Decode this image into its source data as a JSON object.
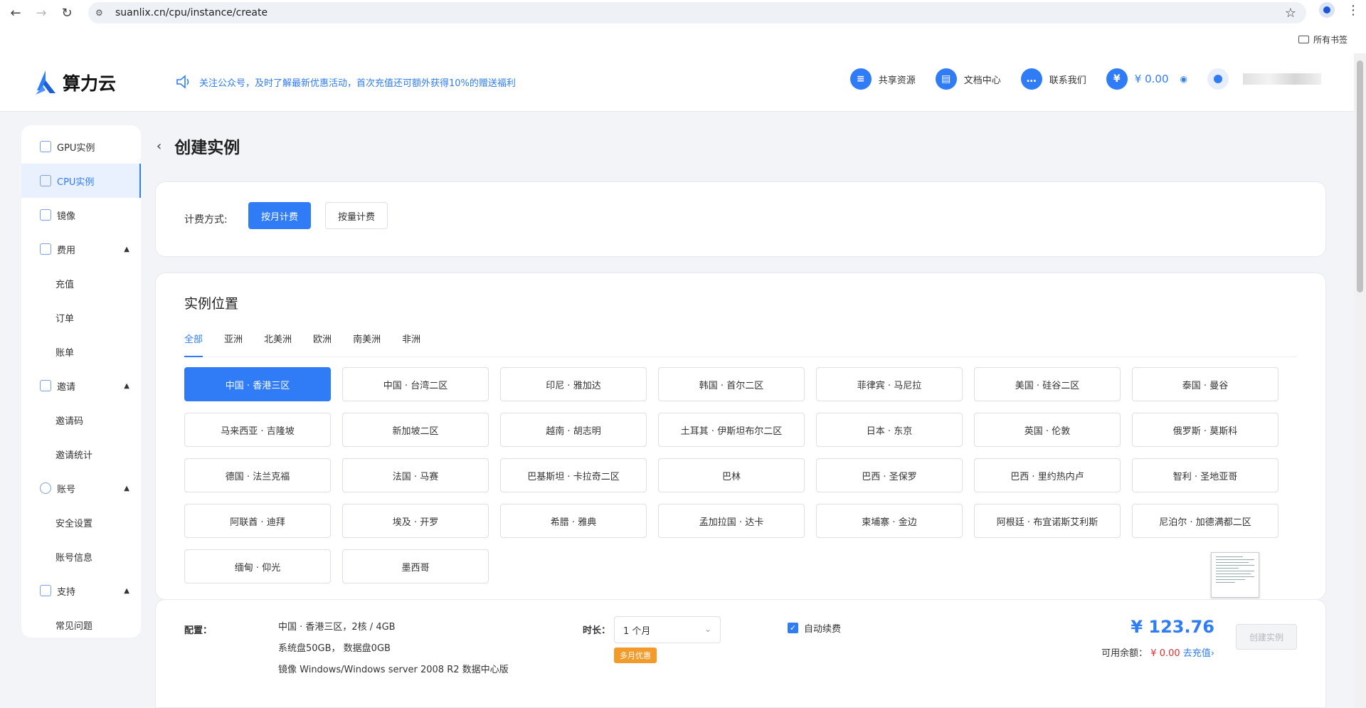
{
  "browser": {
    "url": "suanlix.cn/cpu/instance/create",
    "bookmarks_label": "所有书签"
  },
  "header": {
    "brand": "算力云",
    "notice": "关注公众号，及时了解最新优惠活动，首次充值还可额外获得10%的赠送福利",
    "links": [
      {
        "label": "共享资源",
        "icon": "database-icon"
      },
      {
        "label": "文档中心",
        "icon": "document-icon"
      },
      {
        "label": "联系我们",
        "icon": "chat-icon"
      }
    ],
    "balance": "¥ 0.00",
    "accent": "#2f7cf6"
  },
  "sidebar": {
    "items": [
      {
        "label": "GPU实例",
        "type": "item"
      },
      {
        "label": "CPU实例",
        "type": "item",
        "active": true
      },
      {
        "label": "镜像",
        "type": "item"
      },
      {
        "label": "费用",
        "type": "group"
      },
      {
        "label": "充值",
        "type": "sub"
      },
      {
        "label": "订单",
        "type": "sub"
      },
      {
        "label": "账单",
        "type": "sub"
      },
      {
        "label": "邀请",
        "type": "group"
      },
      {
        "label": "邀请码",
        "type": "sub"
      },
      {
        "label": "邀请统计",
        "type": "sub"
      },
      {
        "label": "账号",
        "type": "group"
      },
      {
        "label": "安全设置",
        "type": "sub"
      },
      {
        "label": "账号信息",
        "type": "sub"
      },
      {
        "label": "支持",
        "type": "group"
      },
      {
        "label": "常见问题",
        "type": "sub"
      }
    ]
  },
  "page": {
    "title": "创建实例"
  },
  "billing": {
    "label": "计费方式:",
    "options": [
      "按月计费",
      "按量计费"
    ],
    "selected": "按月计费"
  },
  "location": {
    "title": "实例位置",
    "tabs": [
      "全部",
      "亚洲",
      "北美洲",
      "欧洲",
      "南美洲",
      "非洲"
    ],
    "active_tab": "全部",
    "regions": [
      "中国 · 香港三区",
      "中国 · 台湾二区",
      "印尼 · 雅加达",
      "韩国 · 首尔二区",
      "菲律宾 · 马尼拉",
      "美国 · 硅谷二区",
      "泰国 · 曼谷",
      "马来西亚 · 吉隆坡",
      "新加坡二区",
      "越南 · 胡志明",
      "土耳其 · 伊斯坦布尔二区",
      "日本 · 东京",
      "英国 · 伦敦",
      "俄罗斯 · 莫斯科",
      "德国 · 法兰克福",
      "法国 · 马赛",
      "巴基斯坦 · 卡拉奇二区",
      "巴林",
      "巴西 · 圣保罗",
      "巴西 · 里约热内卢",
      "智利 · 圣地亚哥",
      "阿联酋 · 迪拜",
      "埃及 · 开罗",
      "希腊 · 雅典",
      "孟加拉国 · 达卡",
      "柬埔寨 · 金边",
      "阿根廷 · 布宜诺斯艾利斯",
      "尼泊尔 · 加德满都二区",
      "缅甸 · 仰光",
      "墨西哥"
    ],
    "selected": "中国 · 香港三区"
  },
  "summary": {
    "config_label": "配置：",
    "config_lines": [
      "中国 · 香港三区，2核 / 4GB",
      "系统盘50GB， 数据盘0GB",
      "镜像 Windows/Windows server 2008 R2 数据中心版"
    ],
    "duration_label": "时长：",
    "duration_value": "1 个月",
    "discount_tag": "多月优惠",
    "auto_renew_label": "自动续费",
    "auto_renew_checked": true,
    "price": "¥ 123.76",
    "available_label": "可用余额：",
    "available_value": "¥ 0.00",
    "recharge_link": "去充值›",
    "create_button": "创建实例"
  }
}
